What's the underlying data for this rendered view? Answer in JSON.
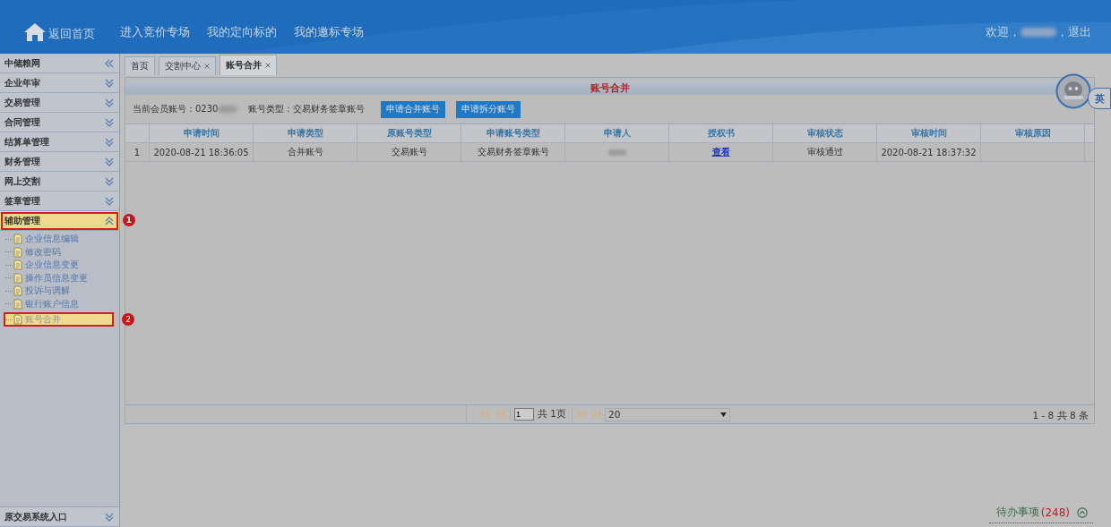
{
  "header": {
    "home": "返回首页",
    "nav": [
      "进入竞价专场",
      "我的定向标的",
      "我的邀标专场"
    ],
    "welcome": "欢迎，",
    "logout": "，退出"
  },
  "sidebar": {
    "title": "中储粮网",
    "menus": [
      {
        "label": "企业年审",
        "expanded": false
      },
      {
        "label": "交易管理",
        "expanded": false
      },
      {
        "label": "合同管理",
        "expanded": false
      },
      {
        "label": "结算单管理",
        "expanded": false
      },
      {
        "label": "财务管理",
        "expanded": false
      },
      {
        "label": "网上交割",
        "expanded": false
      },
      {
        "label": "签章管理",
        "expanded": false
      },
      {
        "label": "辅助管理",
        "expanded": true,
        "callout": "1",
        "children": [
          {
            "label": "企业信息编辑",
            "selected": false
          },
          {
            "label": "修改密码",
            "selected": false
          },
          {
            "label": "企业信息变更",
            "selected": false
          },
          {
            "label": "操作员信息变更",
            "selected": false
          },
          {
            "label": "投诉与调解",
            "selected": false
          },
          {
            "label": "银行账户信息",
            "selected": false
          },
          {
            "label": "账号合并",
            "selected": true,
            "callout": "2"
          }
        ]
      }
    ],
    "footer": "原交易系统入口"
  },
  "tabs": [
    {
      "label": "首页",
      "closable": false,
      "selected": false
    },
    {
      "label": "交割中心",
      "closable": true,
      "selected": false
    },
    {
      "label": "账号合并",
      "closable": true,
      "selected": true
    }
  ],
  "panel": {
    "title": "账号合并",
    "account": "当前会员账号：0230",
    "account_type": "账号类型：交易财务签章账号",
    "buttons": [
      "申请合并账号",
      "申请拆分账号"
    ]
  },
  "table": {
    "columns": [
      "申请时间",
      "申请类型",
      "原账号类型",
      "申请账号类型",
      "申请人",
      "授权书",
      "审核状态",
      "审核时间",
      "审核原因"
    ],
    "rows": [
      {
        "index": "1",
        "cells": [
          {
            "kind": "text",
            "text": "2020-08-21 18:36:05"
          },
          {
            "kind": "text",
            "text": "合并账号"
          },
          {
            "kind": "text",
            "text": "交易账号"
          },
          {
            "kind": "text",
            "text": "交易财务签章账号"
          },
          {
            "kind": "redacted"
          },
          {
            "kind": "link",
            "text": "查看"
          },
          {
            "kind": "text",
            "text": "审核通过"
          },
          {
            "kind": "text",
            "text": "2020-08-21 18:37:32"
          }
        ]
      }
    ]
  },
  "pager": {
    "page": "1",
    "total": "共  1页",
    "page_size": "20",
    "summary": "1 - 8   共 8 条"
  },
  "todo": {
    "label": "待办事项",
    "count": "(248)"
  },
  "lang": "英"
}
